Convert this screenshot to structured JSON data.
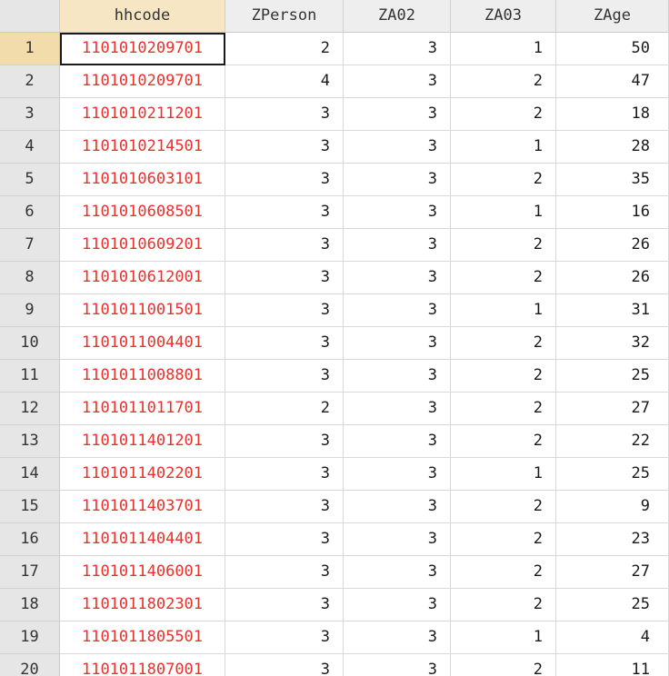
{
  "columns": [
    {
      "key": "hhcode",
      "label": "hhcode"
    },
    {
      "key": "zperson",
      "label": "ZPerson"
    },
    {
      "key": "za02",
      "label": "ZA02"
    },
    {
      "key": "za03",
      "label": "ZA03"
    },
    {
      "key": "zage",
      "label": "ZAge"
    }
  ],
  "colors": {
    "string_value": "#e8322c",
    "selection_header": "#f3dcab"
  },
  "rows": [
    {
      "n": "1",
      "hhcode": "1101010209701",
      "zperson": "2",
      "za02": "3",
      "za03": "1",
      "zage": "50"
    },
    {
      "n": "2",
      "hhcode": "1101010209701",
      "zperson": "4",
      "za02": "3",
      "za03": "2",
      "zage": "47"
    },
    {
      "n": "3",
      "hhcode": "1101010211201",
      "zperson": "3",
      "za02": "3",
      "za03": "2",
      "zage": "18"
    },
    {
      "n": "4",
      "hhcode": "1101010214501",
      "zperson": "3",
      "za02": "3",
      "za03": "1",
      "zage": "28"
    },
    {
      "n": "5",
      "hhcode": "1101010603101",
      "zperson": "3",
      "za02": "3",
      "za03": "2",
      "zage": "35"
    },
    {
      "n": "6",
      "hhcode": "1101010608501",
      "zperson": "3",
      "za02": "3",
      "za03": "1",
      "zage": "16"
    },
    {
      "n": "7",
      "hhcode": "1101010609201",
      "zperson": "3",
      "za02": "3",
      "za03": "2",
      "zage": "26"
    },
    {
      "n": "8",
      "hhcode": "1101010612001",
      "zperson": "3",
      "za02": "3",
      "za03": "2",
      "zage": "26"
    },
    {
      "n": "9",
      "hhcode": "1101011001501",
      "zperson": "3",
      "za02": "3",
      "za03": "1",
      "zage": "31"
    },
    {
      "n": "10",
      "hhcode": "1101011004401",
      "zperson": "3",
      "za02": "3",
      "za03": "2",
      "zage": "32"
    },
    {
      "n": "11",
      "hhcode": "1101011008801",
      "zperson": "3",
      "za02": "3",
      "za03": "2",
      "zage": "25"
    },
    {
      "n": "12",
      "hhcode": "1101011011701",
      "zperson": "2",
      "za02": "3",
      "za03": "2",
      "zage": "27"
    },
    {
      "n": "13",
      "hhcode": "1101011401201",
      "zperson": "3",
      "za02": "3",
      "za03": "2",
      "zage": "22"
    },
    {
      "n": "14",
      "hhcode": "1101011402201",
      "zperson": "3",
      "za02": "3",
      "za03": "1",
      "zage": "25"
    },
    {
      "n": "15",
      "hhcode": "1101011403701",
      "zperson": "3",
      "za02": "3",
      "za03": "2",
      "zage": "9"
    },
    {
      "n": "16",
      "hhcode": "1101011404401",
      "zperson": "3",
      "za02": "3",
      "za03": "2",
      "zage": "23"
    },
    {
      "n": "17",
      "hhcode": "1101011406001",
      "zperson": "3",
      "za02": "3",
      "za03": "2",
      "zage": "27"
    },
    {
      "n": "18",
      "hhcode": "1101011802301",
      "zperson": "3",
      "za02": "3",
      "za03": "2",
      "zage": "25"
    },
    {
      "n": "19",
      "hhcode": "1101011805501",
      "zperson": "3",
      "za02": "3",
      "za03": "1",
      "zage": "4"
    },
    {
      "n": "20",
      "hhcode": "1101011807001",
      "zperson": "3",
      "za02": "3",
      "za03": "2",
      "zage": "11"
    }
  ]
}
